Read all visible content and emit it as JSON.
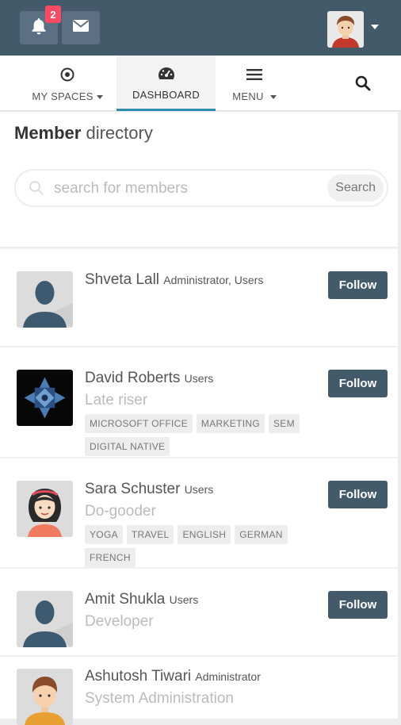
{
  "header": {
    "notification_count": "2",
    "icons": [
      "bell-icon",
      "envelope-icon",
      "user-avatar",
      "caret-down-icon"
    ]
  },
  "nav": {
    "my_spaces": "MY SPACES",
    "dashboard": "DASHBOARD",
    "menu": "MENU",
    "accent": "#2c8faf"
  },
  "directory": {
    "title_bold": "Member",
    "title_rest": "directory",
    "search_placeholder": "search for members",
    "search_button": "Search"
  },
  "members": [
    {
      "name": "Shveta Lall",
      "role": "Administrator, Users",
      "tagline": "",
      "tags": [],
      "follow": "Follow"
    },
    {
      "name": "David Roberts",
      "role": "Users",
      "tagline": "Late riser",
      "tags": [
        "MICROSOFT OFFICE",
        "MARKETING",
        "SEM",
        "DIGITAL NATIVE"
      ],
      "follow": "Follow"
    },
    {
      "name": "Sara Schuster",
      "role": "Users",
      "tagline": "Do-gooder",
      "tags": [
        "YOGA",
        "TRAVEL",
        "ENGLISH",
        "GERMAN",
        "FRENCH"
      ],
      "follow": "Follow"
    },
    {
      "name": "Amit Shukla",
      "role": "Users",
      "tagline": "Developer",
      "tags": [],
      "follow": "Follow"
    },
    {
      "name": "Ashutosh Tiwari",
      "role": "Administrator",
      "tagline": "System Administration",
      "tags": [],
      "follow": ""
    }
  ],
  "colors": {
    "header_bg": "#435a6b",
    "button_bg": "#435a6b",
    "badge": "#fc4a64"
  }
}
